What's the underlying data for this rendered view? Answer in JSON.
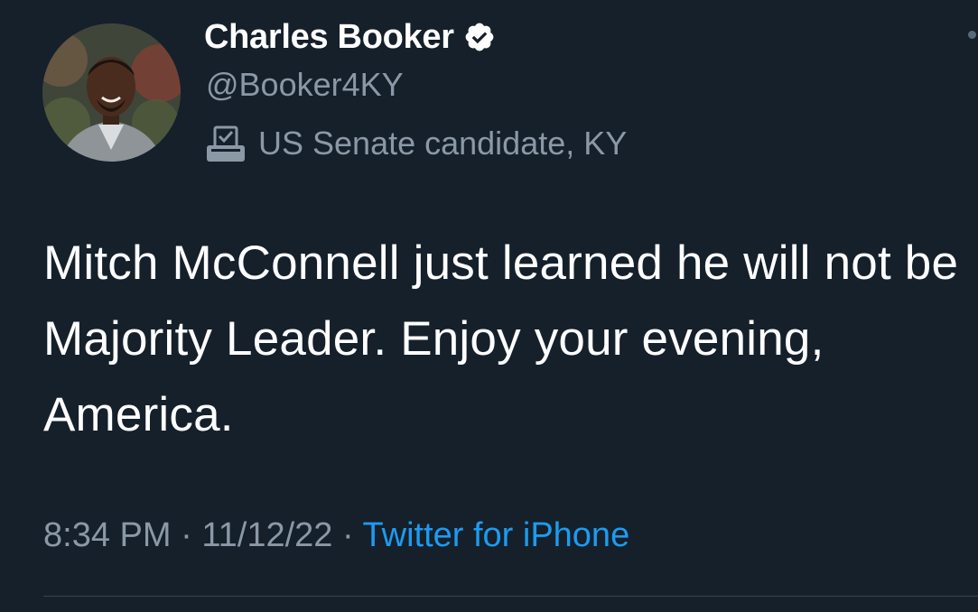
{
  "author": {
    "display_name": "Charles Booker",
    "handle": "@Booker4KY",
    "verified": true,
    "label": "US Senate candidate, KY",
    "label_icon": "ballot-box-icon"
  },
  "tweet": {
    "text": "Mitch McConnell just learned he will not be Majority Leader. Enjoy your evening, America."
  },
  "meta": {
    "time": "8:34 PM",
    "separator": "·",
    "date": "11/12/22",
    "source": "Twitter for iPhone"
  },
  "colors": {
    "background": "#15202b",
    "text_primary": "#ffffff",
    "text_secondary": "#8b98a5",
    "link": "#1d9bf0",
    "divider": "#38444d"
  }
}
